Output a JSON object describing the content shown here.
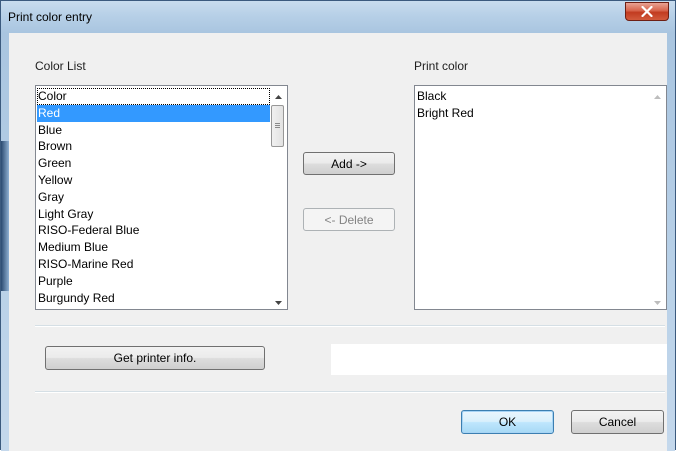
{
  "window": {
    "title": "Print color entry"
  },
  "color_list": {
    "label": "Color List",
    "items": [
      "Color",
      "Red",
      "Blue",
      "Brown",
      "Green",
      "Yellow",
      "Gray",
      "Light Gray",
      "RISO-Federal Blue",
      "Medium Blue",
      "RISO-Marine Red",
      "Purple",
      "Burgundy Red"
    ],
    "selected": "Red",
    "focused": "Color"
  },
  "print_color": {
    "label": "Print color",
    "items": [
      "Black",
      "Bright Red"
    ]
  },
  "buttons": {
    "add": "Add ->",
    "delete": "<- Delete",
    "get_printer_info": "Get printer info.",
    "ok": "OK",
    "cancel": "Cancel"
  },
  "status_text": "",
  "icons": {
    "close": "close-icon",
    "scroll_up": "chevron-up-icon",
    "scroll_down": "chevron-down-icon"
  },
  "colors": {
    "selection": "#3399ff",
    "title_bar": "#b7d0e7",
    "close_button": "#c23b20"
  }
}
